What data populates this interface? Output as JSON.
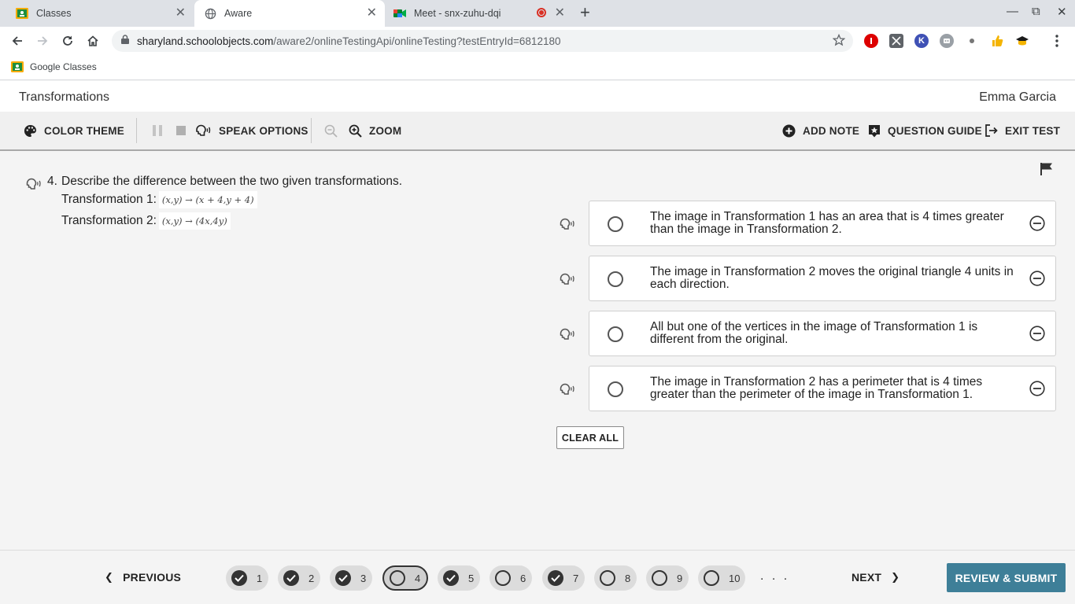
{
  "browser": {
    "tabs": [
      {
        "title": "Classes"
      },
      {
        "title": "Aware"
      },
      {
        "title": "Meet - snx-zuhu-dqi"
      }
    ],
    "url_host": "sharyland.schoolobjects.com",
    "url_path": "/aware2/onlineTestingApi/onlineTesting?testEntryId=6812180",
    "bookmarks": [
      {
        "label": "Google Classes"
      }
    ],
    "extension_k": "K"
  },
  "app": {
    "title": "Transformations",
    "user": "Emma Garcia"
  },
  "toolbar": {
    "color_theme": "COLOR THEME",
    "speak_options": "SPEAK OPTIONS",
    "zoom": "ZOOM",
    "add_note": "ADD NOTE",
    "question_guide": "QUESTION GUIDE",
    "exit_test": "EXIT TEST"
  },
  "question": {
    "number": "4.",
    "text": "Describe the difference between the two given transformations.",
    "t1_label": "Transformation 1:",
    "t1_expr": "(x,y) → (x + 4,y + 4)",
    "t2_label": "Transformation 2:",
    "t2_expr": "(x,y) → (4x,4y)",
    "options": [
      {
        "text": "The image in Transformation 1 has an area that is 4 times greater than the image in Transformation 2."
      },
      {
        "text": "The image in Transformation 2 moves the original triangle 4 units in each direction."
      },
      {
        "text": "All but one of the vertices in the image of Transformation 1 is different from the original."
      },
      {
        "text": "The image in Transformation 2 has a perimeter that is 4 times greater than the perimeter of the image in Transformation 1."
      }
    ],
    "clear_all": "CLEAR ALL"
  },
  "footer": {
    "previous": "PREVIOUS",
    "next": "NEXT",
    "ellipsis": ". . .",
    "review_submit": "REVIEW & SUBMIT",
    "pages": [
      {
        "num": "1",
        "answered": true
      },
      {
        "num": "2",
        "answered": true
      },
      {
        "num": "3",
        "answered": true
      },
      {
        "num": "4",
        "answered": false,
        "current": true
      },
      {
        "num": "5",
        "answered": true
      },
      {
        "num": "6",
        "answered": false
      },
      {
        "num": "7",
        "answered": true
      },
      {
        "num": "8",
        "answered": false
      },
      {
        "num": "9",
        "answered": false
      },
      {
        "num": "10",
        "answered": false
      }
    ]
  },
  "colors": {
    "accent": "#3e7f98",
    "tabstrip": "#dee1e6"
  }
}
